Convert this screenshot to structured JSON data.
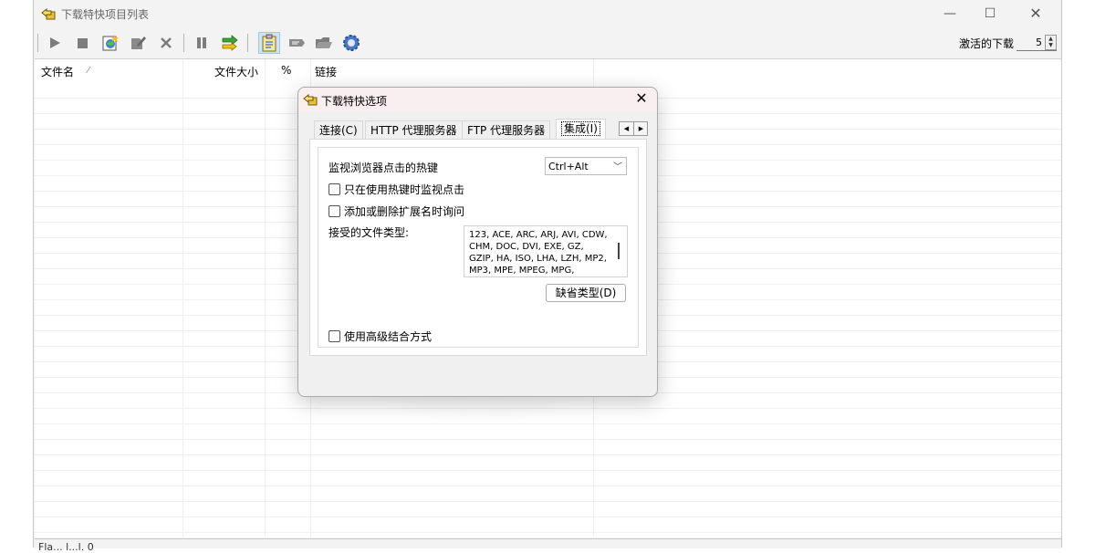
{
  "window": {
    "title": "下载特快项目列表",
    "controls": {
      "minimize": "—",
      "maximize": "☐",
      "close": "✕"
    }
  },
  "toolbar": {
    "active_downloads_label": "激活的下载",
    "active_downloads_value": "5"
  },
  "list": {
    "columns": [
      "文件名",
      "文件大小",
      "%",
      "链接"
    ],
    "sort_indicator": "⁄"
  },
  "statusbar": {
    "text": "Fla... l...l. 0"
  },
  "dialog": {
    "title": "下载特快选项",
    "tabs": [
      "连接(C)",
      "HTTP 代理服务器",
      "FTP 代理服务器",
      "集成(I)"
    ],
    "hotkey_label": "监视浏览器点击的热键",
    "hotkey_value": "Ctrl+Alt",
    "only_hotkey_checkbox": "只在使用热键时监视点击",
    "ask_extensions_checkbox": "添加或删除扩展名时询问",
    "accepted_types_label": "接受的文件类型:",
    "accepted_types": "123, ACE, ARC, ARJ, AVI, CDW, CHM, DOC, DVI, EXE, GZ, GZIP, HA, ISO, LHA, LZH, MP2, MP3, MPE, MPEG, MPG,",
    "default_types_button": "缺省类型(D)",
    "advanced_integration_checkbox": "使用高级结合方式"
  },
  "colors": {
    "accent": "#0078d4",
    "dialog_title_bg": "#f9eef0"
  }
}
